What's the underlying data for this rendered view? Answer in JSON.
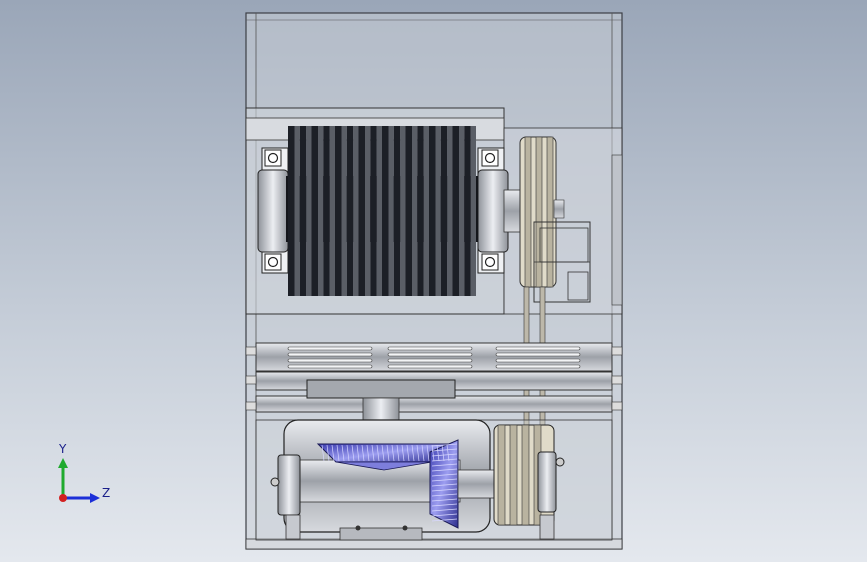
{
  "viewport": {
    "title": "",
    "background_top": "#9aa6b8",
    "background_bottom": "#e4e8ee"
  },
  "model": {
    "frame_color": "#c8ccd4",
    "steel_color": "#b9bcc2",
    "dark_blade_color": "#1c1f26",
    "gear_color": "#6e6fd6",
    "belt_color": "#d9d2c0",
    "blade_count": 16
  },
  "triad": {
    "y_label": "Y",
    "z_label": "Z",
    "y_color": "#1faa2e",
    "z_color": "#1c2fd8",
    "x_color": "#d22020"
  }
}
